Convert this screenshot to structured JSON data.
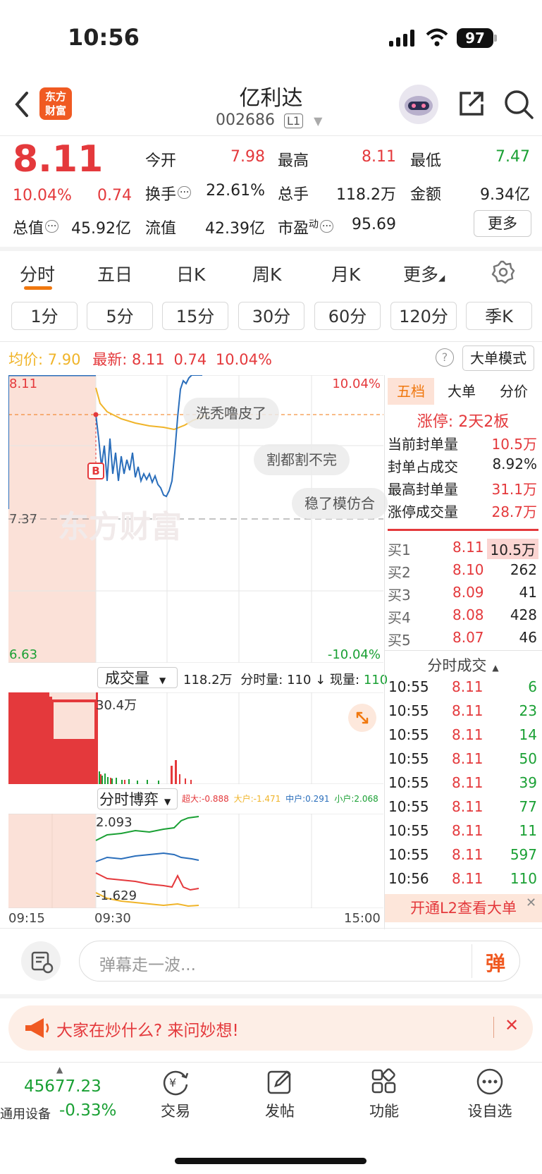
{
  "status": {
    "time": "10:56",
    "battery": "97"
  },
  "header": {
    "stock_name": "亿利达",
    "stock_code": "002686",
    "level": "L1",
    "logo_line1": "东方",
    "logo_line2": "财富"
  },
  "quote": {
    "price": "8.11",
    "change_pct": "10.04%",
    "change": "0.74",
    "open_label": "今开",
    "open": "7.98",
    "high_label": "最高",
    "high": "8.11",
    "low_label": "最低",
    "low": "7.47",
    "turnover_label": "换手",
    "turnover": "22.61%",
    "volume_label": "总手",
    "volume": "118.2万",
    "amount_label": "金额",
    "amount": "9.34亿",
    "mktcap_label": "总值",
    "mktcap": "45.92亿",
    "float_label": "流值",
    "float": "42.39亿",
    "pe_label": "市盈",
    "pe_sup": "动",
    "pe": "95.69",
    "more": "更多"
  },
  "tabs": [
    "分时",
    "五日",
    "日K",
    "周K",
    "月K",
    "更多"
  ],
  "periods": [
    "1分",
    "5分",
    "15分",
    "30分",
    "60分",
    "120分",
    "季K"
  ],
  "chart_header": {
    "avg_label": "均价:",
    "avg": "7.90",
    "last_label": "最新:",
    "last": "8.11",
    "chg": "0.74",
    "pct": "10.04%",
    "big_order_mode": "大单模式"
  },
  "chart_labels": {
    "top_price": "8.11",
    "top_pct": "10.04%",
    "mid_price": "7.37",
    "bottom_price": "6.63",
    "bottom_pct": "-10.04%",
    "b_marker": "B",
    "watermark": "东方财富"
  },
  "danmaku": [
    "洗秃噜皮了",
    "割都割不完",
    "稳了模仿合"
  ],
  "volume_panel": {
    "selector": "成交量",
    "total": "118.2万",
    "minute_label": "分时量:",
    "minute_vol": "110",
    "now_label": "现量:",
    "now_vol": "110",
    "max_label": "30.4万"
  },
  "bo_panel": {
    "selector": "分时博弈",
    "super_label": "超大:",
    "super": "-0.888",
    "big_label": "大户:",
    "big": "-1.471",
    "mid_label": "中户:",
    "mid": "0.291",
    "small_label": "小户:",
    "small": "2.068",
    "max": "2.093",
    "min": "-1.629"
  },
  "time_axis": [
    "09:15",
    "09:30",
    "15:00"
  ],
  "side_tabs": [
    "五档",
    "大单",
    "分价"
  ],
  "limit_info": {
    "title": "涨停: 2天2板",
    "rows": [
      {
        "label": "当前封单量",
        "value": "10.5万"
      },
      {
        "label": "封单占成交",
        "value": "8.92%"
      },
      {
        "label": "最高封单量",
        "value": "31.1万"
      },
      {
        "label": "涨停成交量",
        "value": "28.7万"
      }
    ]
  },
  "bids": [
    {
      "label": "买1",
      "price": "8.11",
      "vol": "10.5万"
    },
    {
      "label": "买2",
      "price": "8.10",
      "vol": "262"
    },
    {
      "label": "买3",
      "price": "8.09",
      "vol": "41"
    },
    {
      "label": "买4",
      "price": "8.08",
      "vol": "428"
    },
    {
      "label": "买5",
      "price": "8.07",
      "vol": "46"
    }
  ],
  "trades_title": "分时成交",
  "trades": [
    {
      "time": "10:55",
      "price": "8.11",
      "vol": "6"
    },
    {
      "time": "10:55",
      "price": "8.11",
      "vol": "23"
    },
    {
      "time": "10:55",
      "price": "8.11",
      "vol": "14"
    },
    {
      "time": "10:55",
      "price": "8.11",
      "vol": "50"
    },
    {
      "time": "10:55",
      "price": "8.11",
      "vol": "39"
    },
    {
      "time": "10:55",
      "price": "8.11",
      "vol": "77"
    },
    {
      "time": "10:55",
      "price": "8.11",
      "vol": "11"
    },
    {
      "time": "10:55",
      "price": "8.11",
      "vol": "597"
    },
    {
      "time": "10:56",
      "price": "8.11",
      "vol": "110"
    }
  ],
  "l2_banner": "开通L2查看大单",
  "comment": {
    "placeholder": "弹幕走一波...",
    "send": "弹"
  },
  "promo": "大家在炒什么? 来问妙想!",
  "bottom_nav": {
    "index_value": "45677.23",
    "index_name": "通用设备",
    "index_pct": "-0.33%",
    "items": [
      "交易",
      "发帖",
      "功能",
      "设自选"
    ]
  },
  "colors": {
    "up": "#e4393c",
    "down": "#1aa034",
    "accent": "#f0780f",
    "price_line": "#2a6ebb",
    "avg_line": "#f0b429"
  }
}
